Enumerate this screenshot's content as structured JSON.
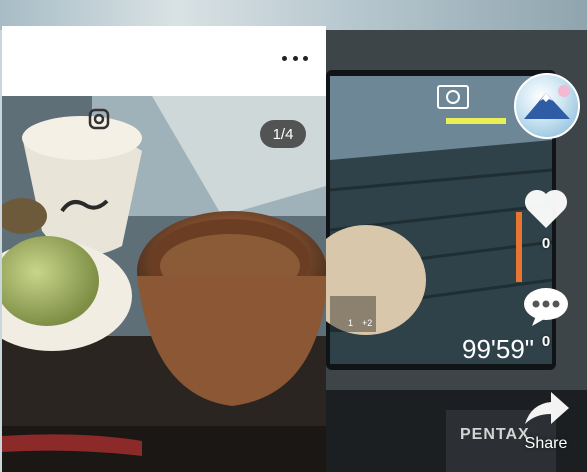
{
  "post": {
    "page_counter": "1/4"
  },
  "camera_screen": {
    "timer": "99'59\"",
    "brand": "PENTAX",
    "exposure_left": "1",
    "exposure_right": "+2"
  },
  "actions": {
    "like_count": "0",
    "comment_count": "0",
    "share_label": "Share"
  },
  "icons": {
    "more": "more-horizontal-icon",
    "like": "heart-icon",
    "comment": "comment-bubble-icon",
    "share": "share-arrow-icon"
  }
}
